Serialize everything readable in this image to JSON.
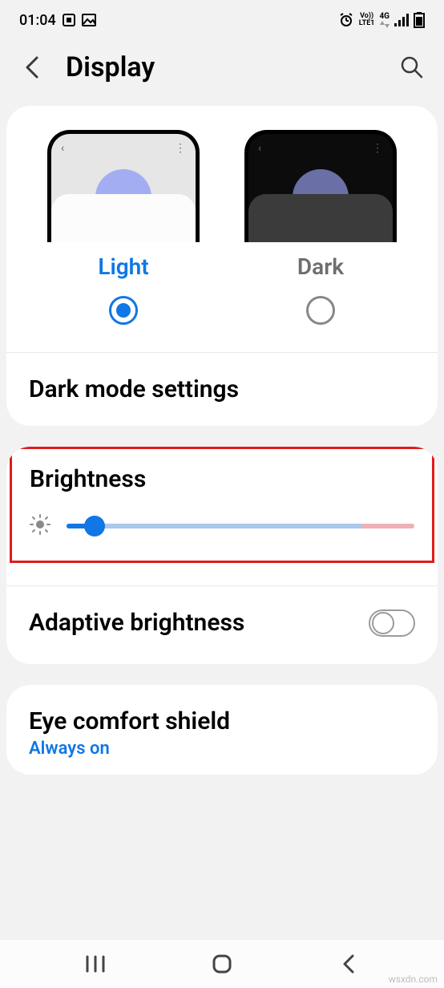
{
  "statusbar": {
    "time": "01:04",
    "lte_label": "LTE1",
    "vo_label": "Vo))",
    "net_label": "4G"
  },
  "header": {
    "title": "Display"
  },
  "theme": {
    "light_label": "Light",
    "dark_label": "Dark",
    "selected": "light"
  },
  "dark_mode_settings": {
    "title": "Dark mode settings"
  },
  "brightness": {
    "title": "Brightness",
    "value_percent": 8
  },
  "adaptive": {
    "title": "Adaptive brightness",
    "enabled": false
  },
  "eye_comfort": {
    "title": "Eye comfort shield",
    "subtitle": "Always on"
  },
  "watermark": "wsxdn.com"
}
